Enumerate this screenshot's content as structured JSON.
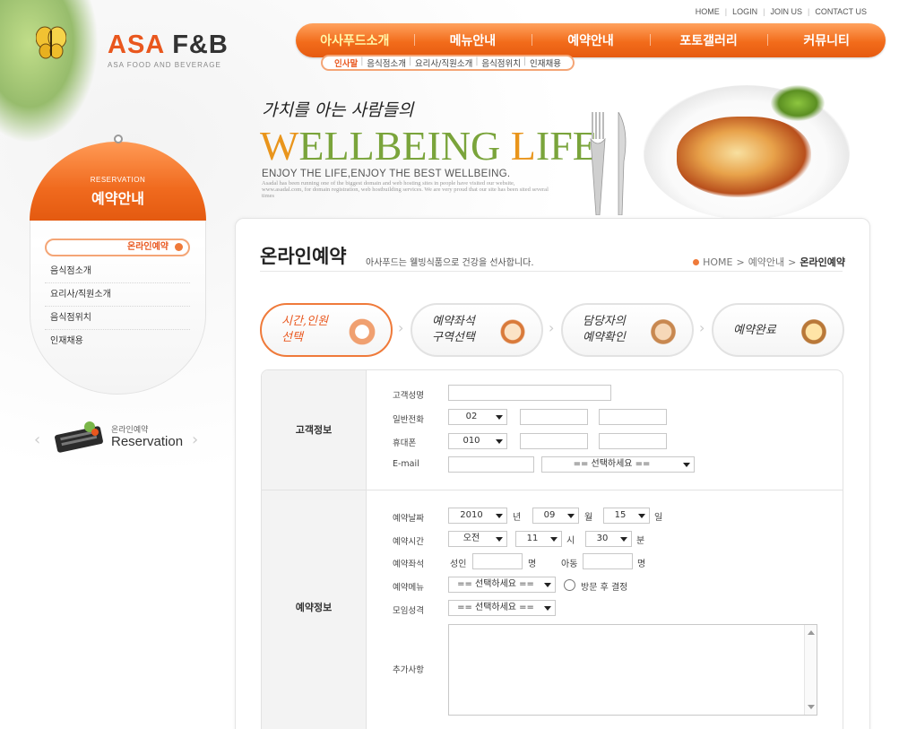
{
  "brand": {
    "logo_asa": "ASA",
    "logo_fb": "F&B",
    "logo_sub": "ASA FOOD AND BEVERAGE"
  },
  "util_nav": [
    "HOME",
    "LOGIN",
    "JOIN US",
    "CONTACT US"
  ],
  "main_nav": [
    "아사푸드소개",
    "메뉴안내",
    "예약안내",
    "포토갤러리",
    "커뮤니티"
  ],
  "sub_nav": [
    "인사말",
    "음식점소개",
    "요리사/직원소개",
    "음식점위치",
    "인재채용"
  ],
  "banner": {
    "script": "가치를 아는 사람들의",
    "w": "W",
    "ellbeing": "ELLBEING ",
    "l": "L",
    "ife": "IFE",
    "enjoy": "ENJOY THE LIFE,ENJOY THE BEST WELLBEING.",
    "small": "Asadal has been running one of the biggest domain and web hosting sites in people have visited our website, www.asadal.com, for domain registration, web hostbuilding services. We are very proud that our site has been sited several times"
  },
  "left": {
    "head_en": "RESERVATION",
    "head_ko": "예약안내",
    "menu": [
      "온라인예약",
      "음식점소개",
      "요리사/직원소개",
      "음식점위치",
      "인재채용"
    ],
    "banner_small": "온라인예약",
    "banner_big": "Reservation"
  },
  "content": {
    "title": "온라인예약",
    "subtitle": "아사푸드는 웰빙식품으로 건강을 선사합니다.",
    "breadcrumb": [
      "HOME",
      "예약안내",
      "온라인예약"
    ]
  },
  "steps": [
    {
      "line1": "시간,인원",
      "line2": "선택"
    },
    {
      "line1": "예약좌석",
      "line2": "구역선택"
    },
    {
      "line1": "담당자의",
      "line2": "예약확인"
    },
    {
      "line1": "예약완료",
      "line2": ""
    }
  ],
  "form": {
    "customer_section": "고객정보",
    "reservation_section": "예약정보",
    "labels": {
      "name": "고객성명",
      "phone": "일반전화",
      "mobile": "휴대폰",
      "email": "E-mail",
      "date": "예약날짜",
      "time": "예약시간",
      "seats": "예약좌석",
      "menu": "예약메뉴",
      "purpose": "모임성격",
      "extra": "추가사항"
    },
    "phone_prefix": "02",
    "mobile_prefix": "010",
    "email_domain": "== 선택하세요 ==",
    "year": "2010",
    "year_unit": "년",
    "month": "09",
    "month_unit": "월",
    "day": "15",
    "day_unit": "일",
    "ampm": "오전",
    "hour": "11",
    "hour_unit": "시",
    "minute": "30",
    "minute_unit": "분",
    "adult_label": "성인",
    "adult_unit": "명",
    "child_label": "아동",
    "child_unit": "명",
    "menu_select": "== 선택하세요 ==",
    "visit_decide": "방문 후 결정",
    "purpose_select": "== 선택하세요 =="
  }
}
